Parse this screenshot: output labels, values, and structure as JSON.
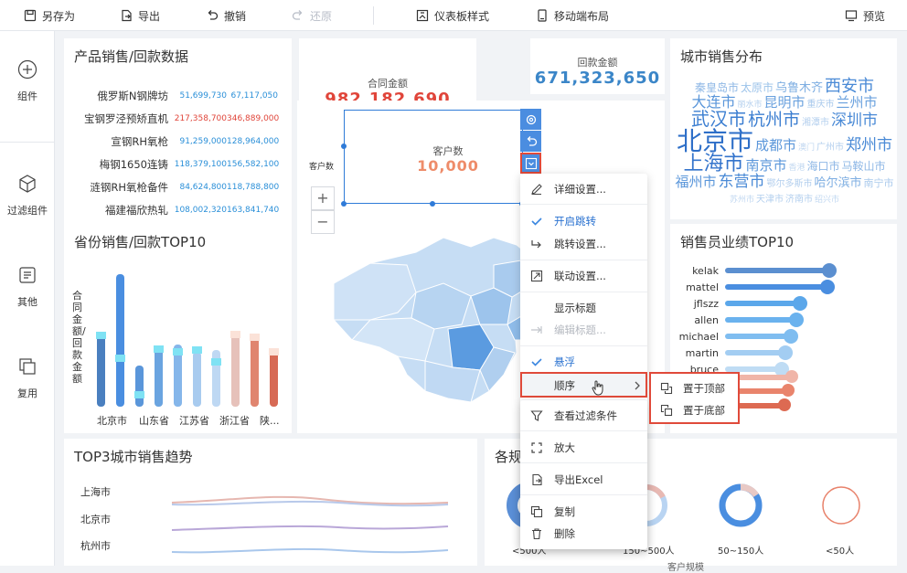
{
  "toolbar": {
    "save_as": "另存为",
    "export": "导出",
    "undo": "撤销",
    "redo": "还原",
    "dashboard_style": "仪表板样式",
    "mobile_layout": "移动端布局",
    "preview": "预览"
  },
  "sidebar": {
    "items": [
      {
        "label": "组件",
        "icon": "plus-circle-icon"
      },
      {
        "label": "过滤组件",
        "icon": "cube-icon"
      },
      {
        "label": "其他",
        "icon": "text-icon"
      },
      {
        "label": "复用",
        "icon": "copy-icon"
      }
    ]
  },
  "product_card": {
    "title": "产品销售/回款数据",
    "rows": [
      {
        "name": "俄罗斯N钢牌坊",
        "a": "51,699,730",
        "b": "67,117,050",
        "a_red": false
      },
      {
        "name": "宝钢罗泾预矫直机",
        "a": "217,358,700",
        "b": "346,889,000",
        "a_red": true
      },
      {
        "name": "宣钢RH氧枪",
        "a": "91,259,000",
        "b": "128,964,000",
        "a_red": false
      },
      {
        "name": "梅钢1650连铸",
        "a": "118,379,100",
        "b": "156,582,100",
        "a_red": false
      },
      {
        "name": "涟钢RH氧枪备件",
        "a": "84,624,800",
        "b": "118,788,800",
        "a_red": false
      },
      {
        "name": "福建福欣热轧",
        "a": "108,002,320",
        "b": "163,841,740",
        "a_red": false
      }
    ]
  },
  "kpis": {
    "contract_label": "合同金额",
    "contract_value": "982,182,690",
    "payment_label": "回款金额",
    "payment_value": "671,323,650",
    "customer_label": "客户数",
    "customer_value": "10,000",
    "customer_axis": "客户数"
  },
  "province_card": {
    "title": "省份销售/回款TOP10",
    "ylabel": "合同金额/回款金额",
    "xlabels": [
      "北京市",
      "山东省",
      "江苏省",
      "浙江省",
      "陕..."
    ]
  },
  "city_card": {
    "title": "城市销售分布",
    "words": [
      {
        "t": "秦皇岛市",
        "s": 12,
        "c": "#8fb8e6"
      },
      {
        "t": "太原市",
        "s": 12,
        "c": "#9cc3ea"
      },
      {
        "t": "乌鲁木齐",
        "s": 13,
        "c": "#7eaee2"
      },
      {
        "t": "西安市",
        "s": 18,
        "c": "#4a8ad6"
      },
      {
        "t": "大连市",
        "s": 16,
        "c": "#5a96da"
      },
      {
        "t": "丽水市",
        "s": 9,
        "c": "#b3cfee"
      },
      {
        "t": "昆明市",
        "s": 15,
        "c": "#6aa1de"
      },
      {
        "t": "重庆市",
        "s": 10,
        "c": "#a9c9ec"
      },
      {
        "t": "兰州市",
        "s": 15,
        "c": "#6aa1de"
      },
      {
        "t": "武汉市",
        "s": 20,
        "c": "#3d7fd1"
      },
      {
        "t": "杭州市",
        "s": 19,
        "c": "#3d7fd1"
      },
      {
        "t": "湘潭市",
        "s": 10,
        "c": "#b3cfee"
      },
      {
        "t": "深圳市",
        "s": 17,
        "c": "#4a8ad6"
      },
      {
        "t": "北京市",
        "s": 28,
        "c": "#2e6fc8"
      },
      {
        "t": "成都市",
        "s": 15,
        "c": "#5a96da"
      },
      {
        "t": "澳门",
        "s": 9,
        "c": "#c2d8f1"
      },
      {
        "t": "广州市",
        "s": 10,
        "c": "#b3cfee"
      },
      {
        "t": "郑州市",
        "s": 17,
        "c": "#4a8ad6"
      },
      {
        "t": "上海市",
        "s": 22,
        "c": "#3474cc"
      },
      {
        "t": "南京市",
        "s": 15,
        "c": "#5a96da"
      },
      {
        "t": "香港",
        "s": 9,
        "c": "#c2d8f1"
      },
      {
        "t": "海口市",
        "s": 12,
        "c": "#8fb8e6"
      },
      {
        "t": "马鞍山市",
        "s": 12,
        "c": "#8fb8e6"
      },
      {
        "t": "福州市",
        "s": 15,
        "c": "#5a96da"
      },
      {
        "t": "东营市",
        "s": 17,
        "c": "#4a8ad6"
      },
      {
        "t": "鄂尔多斯市",
        "s": 10,
        "c": "#b3cfee"
      },
      {
        "t": "哈尔滨市",
        "s": 13,
        "c": "#7eaee2"
      },
      {
        "t": "南宁市",
        "s": 11,
        "c": "#a9c9ec"
      },
      {
        "t": "苏州市",
        "s": 9,
        "c": "#c2d8f1"
      },
      {
        "t": "天津市",
        "s": 10,
        "c": "#b3cfee"
      },
      {
        "t": "济南市",
        "s": 10,
        "c": "#b3cfee"
      },
      {
        "t": "绍兴市",
        "s": 9,
        "c": "#c2d8f1"
      }
    ]
  },
  "sales_card": {
    "title": "销售员业绩TOP10",
    "people": [
      "kelak",
      "mattel",
      "jflszz",
      "allen",
      "michael",
      "martin",
      "bruce"
    ],
    "levels": [
      0.84,
      0.83,
      0.68,
      0.66,
      0.63,
      0.6,
      0.58
    ]
  },
  "trend_card": {
    "title": "TOP3城市销售趋势",
    "cities": [
      "上海市",
      "北京市",
      "杭州市"
    ]
  },
  "scale_card": {
    "title": "各规",
    "labels": [
      "<500人",
      "150~500人",
      "50~150人",
      "<50人"
    ],
    "footer": "客户规模"
  },
  "context_menu": {
    "items": [
      "详细设置...",
      "开启跳转",
      "跳转设置...",
      "联动设置...",
      "显示标题",
      "编辑标题...",
      "悬浮",
      "顺序",
      "查看过滤条件",
      "放大",
      "导出Excel",
      "复制",
      "删除"
    ]
  },
  "submenu": {
    "items": [
      "置于顶部",
      "置于底部"
    ]
  },
  "map": {
    "zoom_in": "+",
    "zoom_out": "−"
  }
}
